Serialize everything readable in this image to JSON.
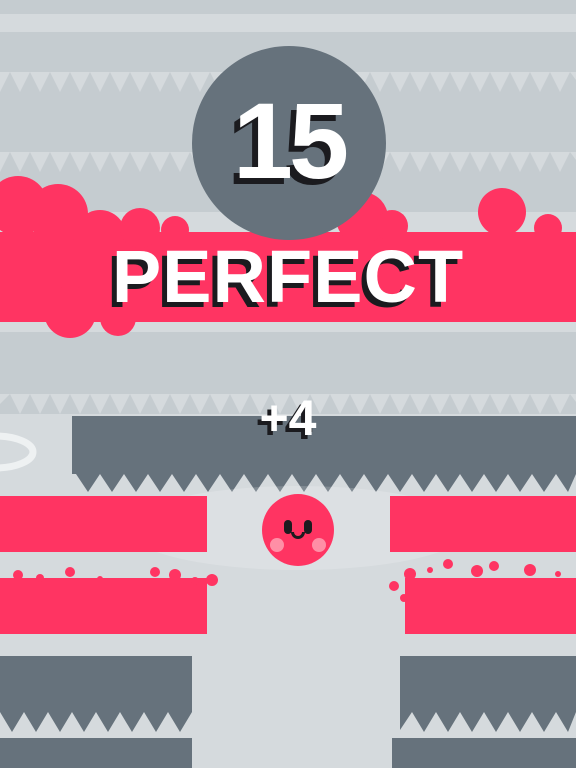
{
  "game": {
    "score": "15",
    "feedback": "PERFECT",
    "bonus": "+4"
  },
  "colors": {
    "background": "#d5dadd",
    "light_band": "#c5ccd0",
    "dark_band": "#66727c",
    "accent": "#ff3462",
    "text": "#ffffff",
    "text_shadow": "#1b1b1f"
  },
  "icons": {
    "player": "pink-ball-character-icon",
    "hazards": "spike-icon"
  }
}
